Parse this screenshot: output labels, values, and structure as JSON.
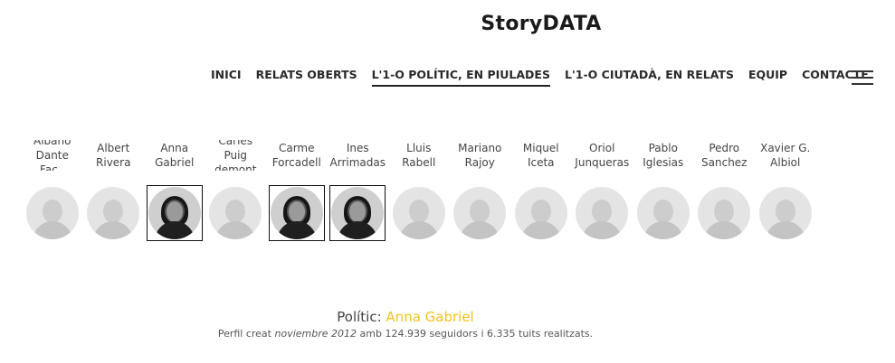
{
  "header": {
    "logo": "StoryDATA"
  },
  "nav": {
    "items": [
      {
        "label": "INICI"
      },
      {
        "label": "RELATS OBERTS"
      },
      {
        "label": "L'1-O POLÍTIC, EN PIULADES",
        "active": true
      },
      {
        "label": "L'1-O CIUTADÀ, EN RELATS"
      },
      {
        "label": "EQUIP"
      },
      {
        "label": "CONTACTE"
      }
    ],
    "menu_icon": "hamburger-icon"
  },
  "politicians": [
    {
      "name": "Albano\nDante Fac..",
      "selected": false
    },
    {
      "name": "Albert\nRivera",
      "selected": false
    },
    {
      "name": "Anna\nGabriel",
      "selected": true
    },
    {
      "name": "Carles Puig\ndemont",
      "selected": false
    },
    {
      "name": "Carme\nForcadell",
      "selected": true
    },
    {
      "name": "Ines\nArrimadas",
      "selected": true
    },
    {
      "name": "Lluis Rabell",
      "selected": false
    },
    {
      "name": "Mariano\nRajoy",
      "selected": false
    },
    {
      "name": "Miquel\nIceta",
      "selected": false
    },
    {
      "name": "Oriol\nJunqueras",
      "selected": false
    },
    {
      "name": "Pablo\nIglesias",
      "selected": false
    },
    {
      "name": "Pedro\nSanchez",
      "selected": false
    },
    {
      "name": "Xavier G.\nAlbiol",
      "selected": false
    }
  ],
  "profile": {
    "label": "Polític:",
    "name": "Anna Gabriel",
    "created_prefix": "Perfil creat",
    "created_date": "noviembre 2012",
    "followers_prefix": "amb",
    "followers": "124.939",
    "followers_suffix": "seguidors i",
    "tweets": "6.335",
    "tweets_suffix": "tuits realitzats."
  },
  "colors": {
    "highlight": "#f2c318"
  }
}
